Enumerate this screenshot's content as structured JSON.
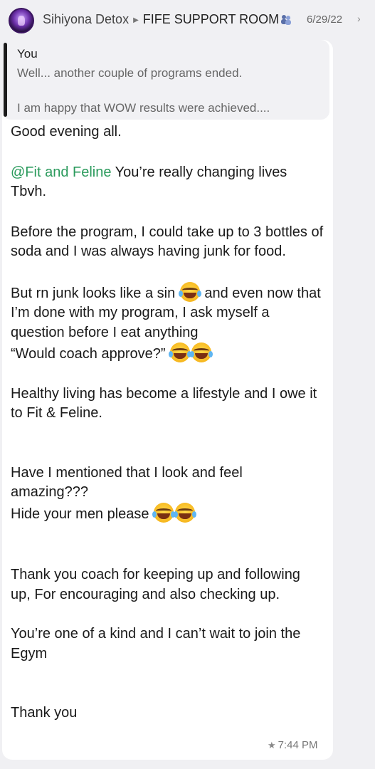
{
  "header": {
    "sender": "Sihiyona Detox",
    "group": "FIFE SUPPORT ROOM",
    "date": "6/29/22",
    "chevron": "›"
  },
  "quote": {
    "author": "You",
    "line1": "Well... another couple of programs ended.",
    "line2": "I am happy that WOW results were achieved...."
  },
  "message": {
    "greeting": "Good evening all.",
    "mention": "@Fit and Feline",
    "p1_rest": " You’re really changing lives Tbvh.",
    "p2": "Before the program, I could take up to 3 bottles of soda and I was always having junk for food.",
    "p3_a": "But rn junk looks like a sin ",
    "p3_b": " and even now that I’m done with my program, I ask myself a question before I eat anything",
    "p3_c": "“Would coach approve?” ",
    "p4": "Healthy living has become a lifestyle and I owe it to Fit & Feline.",
    "p5_a": "Have I mentioned that I look and feel amazing???",
    "p5_b": "Hide your men please ",
    "p6": "Thank you coach for keeping up and following up, For encouraging and also checking up.",
    "p7": "You’re one of a kind and I can’t wait to join the Egym",
    "p8": "Thank you"
  },
  "footer": {
    "star": "★",
    "time": "7:44 PM"
  },
  "icons": {
    "avatar": "avatar-image",
    "emoji": "face-with-tears-of-joy-icon",
    "group": "group-people-icon",
    "starred": "star-icon"
  }
}
